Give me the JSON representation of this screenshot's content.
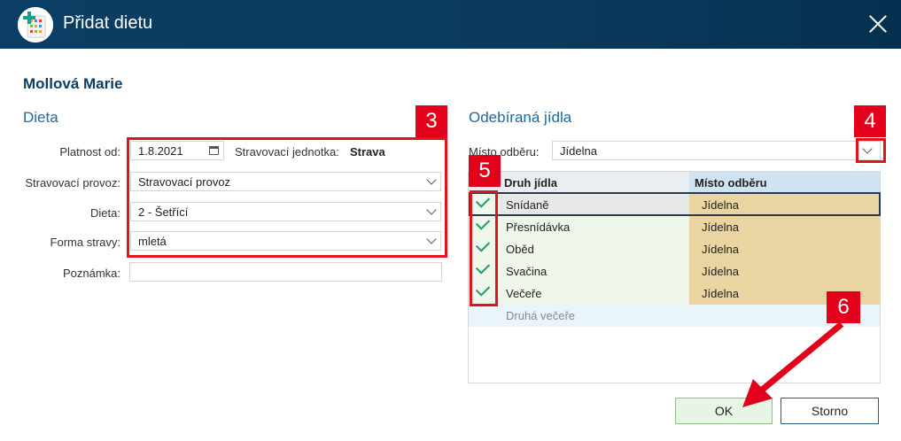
{
  "window": {
    "title": "Přidat dietu"
  },
  "person_name": "Mollová Marie",
  "diet": {
    "section_title": "Dieta",
    "valid_from_label": "Platnost od:",
    "valid_from_value": "1.8.2021",
    "unit_label": "Stravovací jednotka:",
    "unit_value": "Strava",
    "operation_label": "Stravovací provoz:",
    "operation_value": "Stravovací provoz",
    "diet_label": "Dieta:",
    "diet_value": "2 - Šetřící",
    "form_label": "Forma stravy:",
    "form_value": "mletá",
    "note_label": "Poznámka:",
    "note_value": ""
  },
  "meals": {
    "section_title": "Odebíraná jídla",
    "place_label": "Místo odběru:",
    "place_value": "Jídelna",
    "col_meal": "Druh jídla",
    "col_place": "Místo odběru",
    "rows": [
      {
        "meal": "Snídaně",
        "place": "Jídelna",
        "checked": true
      },
      {
        "meal": "Přesnídávka",
        "place": "Jídelna",
        "checked": true
      },
      {
        "meal": "Oběd",
        "place": "Jídelna",
        "checked": true
      },
      {
        "meal": "Svačina",
        "place": "Jídelna",
        "checked": true
      },
      {
        "meal": "Večeře",
        "place": "Jídelna",
        "checked": true
      },
      {
        "meal": "Druhá večeře",
        "place": "",
        "checked": false
      }
    ]
  },
  "annotations": {
    "n3": "3",
    "n4": "4",
    "n5": "5",
    "n6": "6"
  },
  "buttons": {
    "ok": "OK",
    "cancel": "Storno"
  },
  "colors": {
    "titlebar": "#0b3e64",
    "accent": "#1b6aa8",
    "highlight_red": "#e3001b",
    "place_cell": "#ead4a2",
    "check": "#1d9a78"
  }
}
